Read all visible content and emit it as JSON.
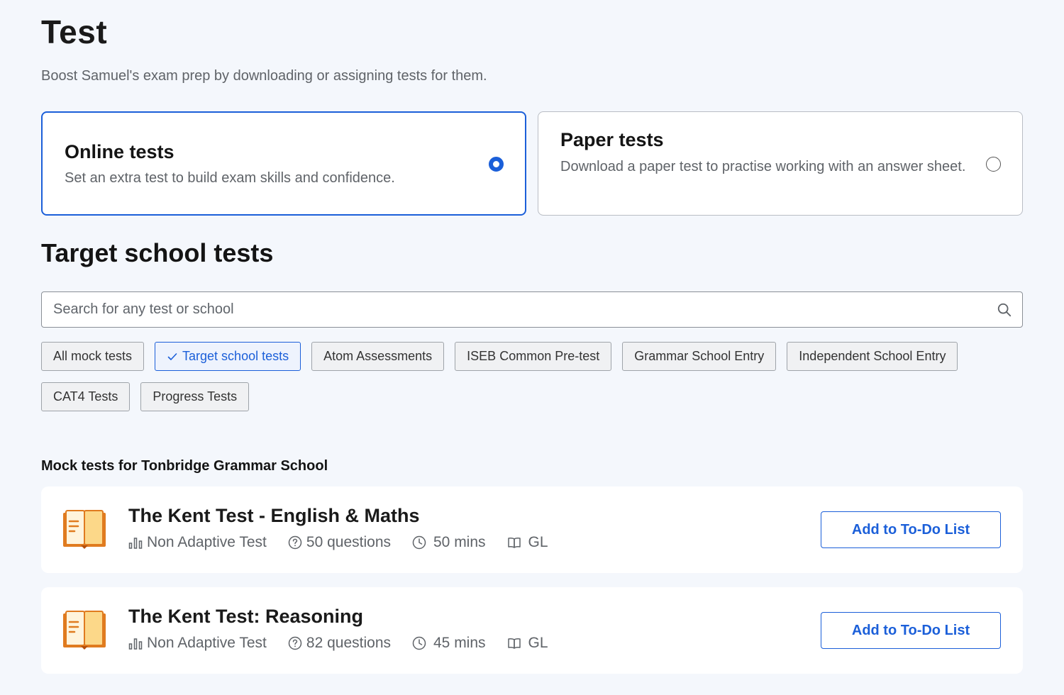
{
  "page": {
    "title": "Test",
    "subtitle": "Boost Samuel's exam prep by downloading or assigning tests for them."
  },
  "modes": [
    {
      "title": "Online tests",
      "description": "Set an extra test to build exam skills and confidence.",
      "selected": true
    },
    {
      "title": "Paper tests",
      "description": "Download a paper test to practise working with an answer sheet.",
      "selected": false
    }
  ],
  "section": {
    "title": "Target school tests",
    "search_placeholder": "Search for any test or school",
    "search_value": ""
  },
  "filters": [
    {
      "label": "All mock tests",
      "active": false
    },
    {
      "label": "Target school tests",
      "active": true
    },
    {
      "label": "Atom Assessments",
      "active": false
    },
    {
      "label": "ISEB Common Pre-test",
      "active": false
    },
    {
      "label": "Grammar School Entry",
      "active": false
    },
    {
      "label": "Independent School Entry",
      "active": false
    },
    {
      "label": "CAT4 Tests",
      "active": false
    },
    {
      "label": "Progress Tests",
      "active": false
    }
  ],
  "list": {
    "heading": "Mock tests for Tonbridge Grammar School",
    "tests": [
      {
        "title": "The Kent Test - English & Maths",
        "type": "Non Adaptive Test",
        "questions": "50 questions",
        "duration": "50 mins",
        "provider": "GL",
        "button_label": "Add to To-Do List"
      },
      {
        "title": "The Kent Test: Reasoning",
        "type": "Non Adaptive Test",
        "questions": "82 questions",
        "duration": "45 mins",
        "provider": "GL",
        "button_label": "Add to To-Do List"
      }
    ]
  },
  "colors": {
    "accent": "#1b5fd9",
    "background": "#f4f7fc",
    "book_orange": "#e07b1f",
    "book_pages": "#fcd889"
  },
  "icons": [
    "radio-icon",
    "search-icon",
    "check-icon",
    "book-icon",
    "bar-chart-icon",
    "question-circle-icon",
    "clock-icon",
    "open-book-icon"
  ]
}
